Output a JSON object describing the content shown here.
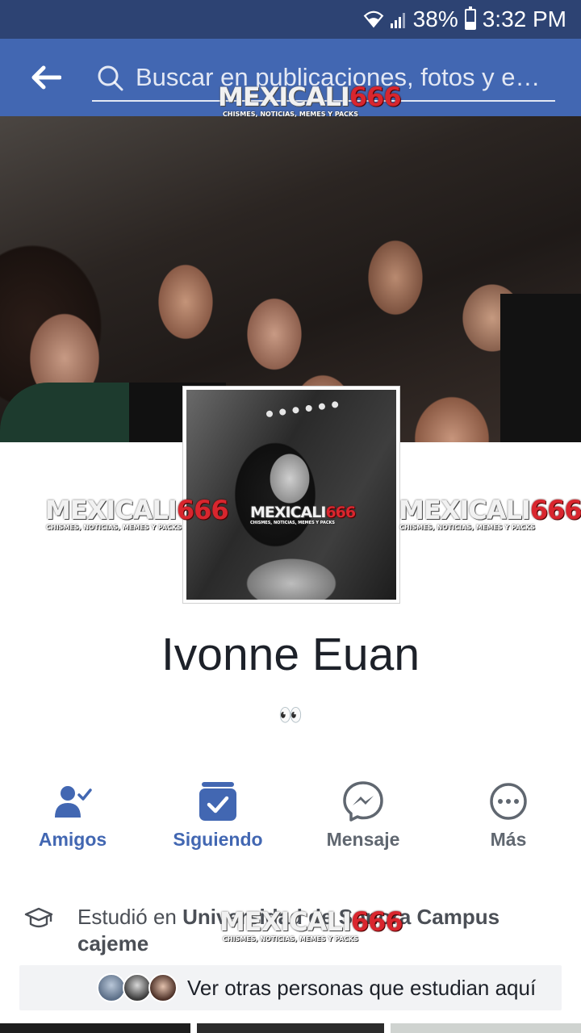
{
  "status_bar": {
    "battery": "38%",
    "battery_level": 0.38,
    "time": "3:32 PM"
  },
  "search": {
    "placeholder": "Buscar en publicaciones, fotos y e…"
  },
  "watermark": {
    "brand_a": "MEXICALI",
    "brand_b": "666",
    "tagline": "CHISMES, NOTICIAS, MEMES Y PACKS"
  },
  "profile": {
    "name": "Ivonne Euan",
    "bio": "👀"
  },
  "actions": [
    {
      "label": "Amigos",
      "icon": "friends-check-icon",
      "color": "#4267b2"
    },
    {
      "label": "Siguiendo",
      "icon": "following-check-icon",
      "color": "#4267b2"
    },
    {
      "label": "Mensaje",
      "icon": "messenger-icon",
      "color": "#606770"
    },
    {
      "label": "Más",
      "icon": "more-icon",
      "color": "#606770"
    }
  ],
  "education": {
    "prefix": "Estudió en ",
    "school": "Universidad de Sonora Campus cajeme"
  },
  "classmates": {
    "label": "Ver otras personas que estudian aquí"
  },
  "colors": {
    "header": "#4267b2",
    "status_bar": "#2d4373",
    "accent": "#4267b2",
    "watermark_red": "#d9262e"
  }
}
